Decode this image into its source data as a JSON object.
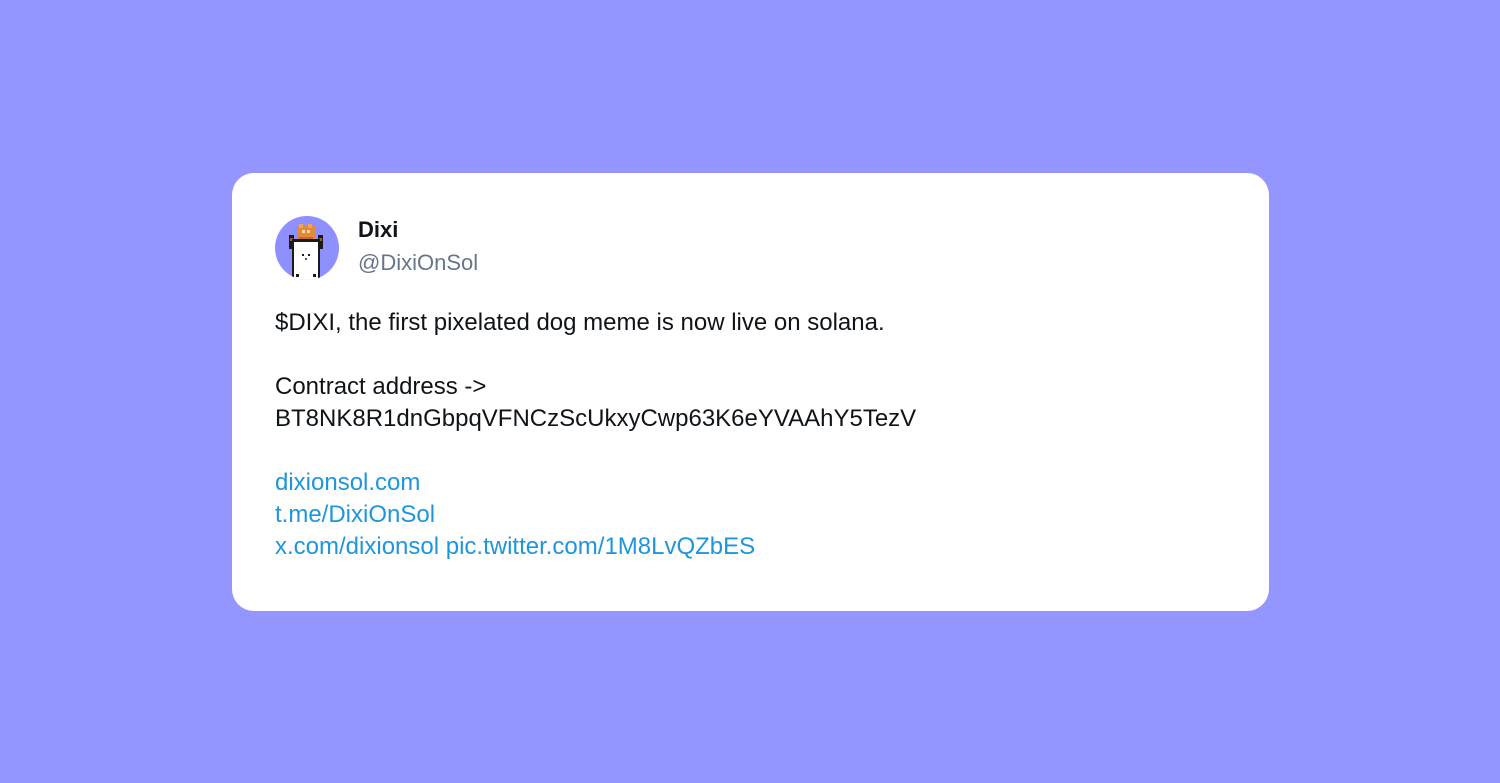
{
  "tweet": {
    "author": {
      "name": "Dixi",
      "handle": "@DixiOnSol",
      "avatar_icon": "pixel-dog-avatar"
    },
    "lines": {
      "intro": "$DIXI, the first pixelated dog meme is now live on solana.",
      "contract_label": "Contract address ->",
      "contract_address": "BT8NK8R1dnGbpqVFNCzScUkxyCwp63K6eYVAAhY5TezV"
    },
    "links": {
      "website": "dixionsol.com",
      "telegram": "t.me/DixiOnSol",
      "x_profile": "x.com/dixionsol",
      "pic": "pic.twitter.com/1M8LvQZbES"
    },
    "colors": {
      "background": "#9595ff",
      "card": "#ffffff",
      "text": "#0f1419",
      "handle": "#66778a",
      "link": "#1f96d9",
      "avatar_bg": "#8f90ff"
    }
  }
}
